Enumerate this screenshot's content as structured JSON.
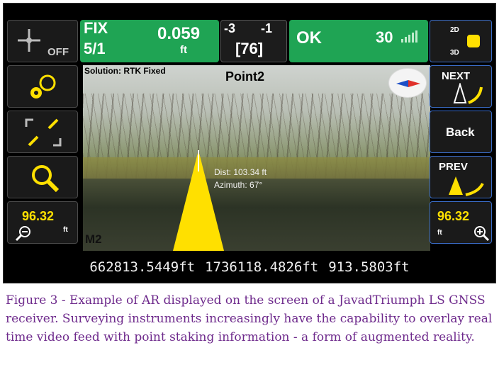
{
  "status": {
    "fix_label": "FIX",
    "fix_ratio": "5/1",
    "precision_value": "0.059",
    "precision_unit": "ft",
    "sat_left": "-3",
    "sat_right": "-1",
    "sat_total": "[76]",
    "ok_label": "OK",
    "signal_count": "30"
  },
  "left_buttons": {
    "gps_off_label": "OFF",
    "zoom_out_value": "96.32",
    "zoom_out_unit": "ft"
  },
  "right_buttons": {
    "view_2d": "2D",
    "view_3d": "3D",
    "next_label": "NEXT",
    "back_label": "Back",
    "prev_label": "PREV",
    "zoom_in_value": "96.32",
    "zoom_in_unit": "ft"
  },
  "ar_view": {
    "solution_text": "Solution: RTK Fixed",
    "point_name": "Point2",
    "distance_text": "Dist: 103.34 ft",
    "azimuth_text": "Azimuth: 67°",
    "marker_label": "M2"
  },
  "coordinates": {
    "northing": "662813.5449ft",
    "easting": "1736118.4826ft",
    "elevation": "913.5803ft"
  },
  "caption": {
    "text": "Figure 3 - Example of AR displayed on the screen of a JavadTriumph LS GNSS receiver. Surveying instruments increasingly have the capability to overlay real time video feed with point staking information - a form of augmented reality."
  },
  "colors": {
    "status_green": "#1fa454",
    "arrow_yellow": "#ffe000",
    "caption_purple": "#6e2a8c",
    "button_border_blue": "#3a6cc7"
  }
}
